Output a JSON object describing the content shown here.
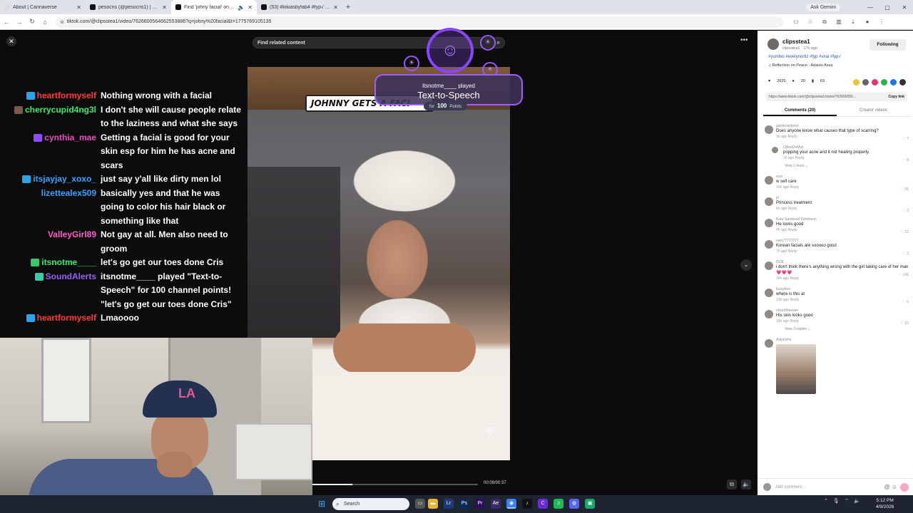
{
  "browser": {
    "tabs": [
      {
        "label": "About | Cannaverse",
        "color": "#e8e8e8"
      },
      {
        "label": "pesocris (@pesocris1) | TikTok",
        "color": "#111111"
      },
      {
        "label": "Find 'johny facial' on TikTok",
        "color": "#111111"
      },
      {
        "label": "(53) #kikiasbyfab4 #fyp√ #yumbo",
        "color": "#111111"
      }
    ],
    "new_tab": "+",
    "ask_gemini": "Ask Gemini",
    "url": "tiktok.com/@clipsstea1/video/7626600564662553886?q=johny%20facial&t=1775769105135"
  },
  "player": {
    "search_placeholder": "Find related content",
    "title_card": "JOHNNY GETS A FACI",
    "timecode": "00:09/00:37",
    "progress": 0.24
  },
  "alert": {
    "user": "itsnotme____ played",
    "title": "Text-to-Speech",
    "for_label": "for",
    "points_value": "100",
    "points_label": "Points"
  },
  "chat": [
    {
      "user": "heartformyself",
      "color": "#ff3b3b",
      "badge": "#2aa3e8",
      "lines": [
        "Nothing wrong with a facial"
      ]
    },
    {
      "user": "cherrycupid4ng3l",
      "color": "#39e86a",
      "badge": "#7a5a4a",
      "lines": [
        "I don't she will cause people relate",
        "to the laziness and what she says"
      ]
    },
    {
      "user": "cynthia_mae",
      "color": "#e84dc0",
      "badge": "#8b4dff",
      "lines": [
        "Getting a facial is good for your",
        "skin esp for him he has acne and",
        "scars"
      ]
    },
    {
      "user": "itsjayjay_xoxo_",
      "color": "#3aa0ff",
      "badge": "#2aa3e8",
      "lines": [
        "just say y'all like dirty men lol"
      ]
    },
    {
      "user": "lizettealex509",
      "color": "#3aa0ff",
      "badge": "",
      "lines": [
        "basically yes and that he was",
        "going to color his hair black or",
        "something like that"
      ]
    },
    {
      "user": "ValleyGirl89",
      "color": "#ff5cc8",
      "badge": "",
      "lines": [
        "Not gay at all. Men also need to",
        "groom"
      ]
    },
    {
      "user": "itsnotme____",
      "color": "#39e86a",
      "badge": "#39c86a",
      "lines": [
        "let's go get our toes done Cris"
      ]
    },
    {
      "user": "SoundAlerts",
      "color": "#9a5cff",
      "badge": "#3ec9a8",
      "lines": [
        "itsnotme____ played \"Text-to-",
        "Speech\" for 100 channel points!",
        "\"let's go get our toes done Cris\""
      ]
    },
    {
      "user": "heartformyself",
      "color": "#ff3b3b",
      "badge": "#2aa3e8",
      "lines": [
        "Lmaoooo"
      ]
    }
  ],
  "sidebar": {
    "username": "clipsstea1",
    "sub": "clipsstea1 · 17h ago",
    "follow_label": "Following",
    "hashtags": "#yumboi #evelynortiz #fyp #viral #fyp√",
    "music": "♫ Reflection on Peace · Adauto Assa",
    "likes": "2625",
    "comments_count": "20",
    "saves": "63",
    "share_colors": [
      "#f2c230",
      "#666666",
      "#e8336a",
      "#29b34f",
      "#1877f2",
      "#333333"
    ],
    "link": "https://www.tiktok.com/@clipsstea1/video/762660056...",
    "copy_link": "Copy link",
    "tab_comments": "Comments (20)",
    "tab_creator": "Creator videos",
    "comment_list": [
      {
        "user": "gardenia4ever",
        "text": "Does anyone know what causes that type of scarring?",
        "meta": "3h ago   Reply",
        "likes": "7",
        "reply": false
      },
      {
        "user": "OjitosDeMiel",
        "text": "popping your acne and it not healing properly",
        "meta": "2h ago   Reply",
        "likes": "8",
        "reply": true
      },
      {
        "user": "sosi",
        "text": "w self care",
        "meta": "16h ago   Reply",
        "likes": "56",
        "reply": false
      },
      {
        "user": "jd",
        "text": "Princess treatment",
        "meta": "6h ago   Reply",
        "likes": "3",
        "reply": false
      },
      {
        "user": "Kara Sandoval Tomlinson",
        "text": "He looks good",
        "meta": "9h ago   Reply",
        "likes": "12",
        "reply": false
      },
      {
        "user": "user77777777",
        "text": "Korean facials are sooooo good",
        "meta": "7h ago   Reply",
        "likes": "3",
        "reply": false
      },
      {
        "user": "GG8",
        "text": "i don't think there's anything wrong with the girl taking care of her man 💗💗💗",
        "meta": "16h ago   Reply",
        "likes": "146",
        "reply": false
      },
      {
        "user": "fuzzyboo",
        "text": "where is this at",
        "meta": "12h ago   Reply",
        "likes": "6",
        "reply": false
      },
      {
        "user": "cloud9heaven",
        "text": "His skin looks good",
        "meta": "16h ago   Reply",
        "likes": "63",
        "reply": false
      },
      {
        "user": "Alejandra",
        "text": "",
        "meta": "",
        "likes": "",
        "reply": false
      }
    ],
    "view_more_1": "View 2 more ⌄",
    "view_more_2": "View 3 replies ⌄",
    "add_comment": "Add comment..."
  },
  "taskbar": {
    "search": "Search",
    "time": "5:12 PM",
    "date": "4/9/2026"
  }
}
